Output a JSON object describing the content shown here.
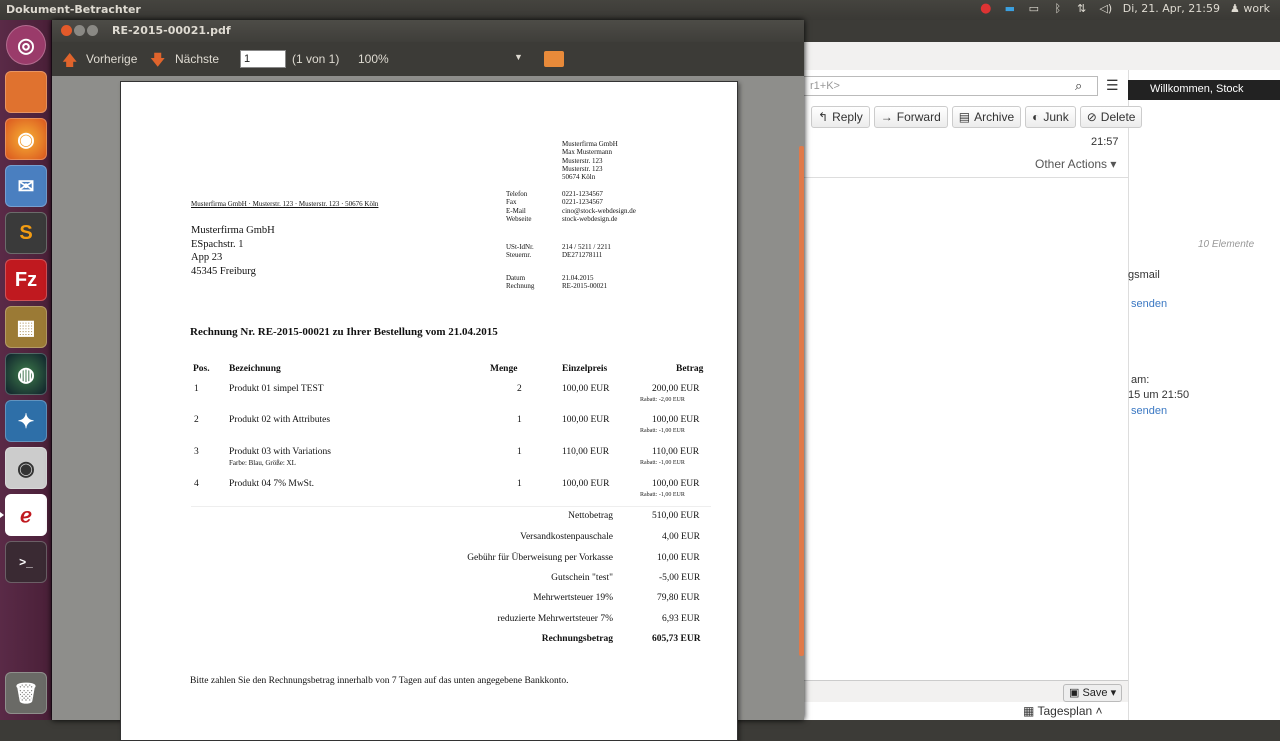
{
  "topbar": {
    "app_title": "Dokument-Betrachter",
    "datetime": "Di, 21. Apr, 21:59",
    "user": "work"
  },
  "launcher": {
    "items": [
      "ubuntu-icon",
      "files-icon",
      "firefox-icon",
      "thunderbird-icon",
      "sublime-icon",
      "filezilla-icon",
      "calc-icon",
      "earth-icon",
      "bird-icon",
      "webcam-icon",
      "evince-icon",
      "terminal-icon",
      "trash-icon"
    ]
  },
  "viewer": {
    "title": "RE-2015-00021.pdf",
    "prev_label": "Vorherige",
    "next_label": "Nächste",
    "page_value": "1",
    "page_count": "(1 von 1)",
    "zoom": "100%"
  },
  "invoice": {
    "sender_line": "Musterfirma GmbH · Musterstr. 123 · Musterstr. 123 · 50676 Köln",
    "company": [
      "Musterfirma GmbH",
      "Max Mustermann",
      "Musterstr. 123",
      "Musterstr. 123",
      "50674 Köln"
    ],
    "contact_labels": [
      "Telefon",
      "Fax",
      "E-Mail",
      "Webseite"
    ],
    "contact_values": [
      "0221-1234567",
      "0221-1234567",
      "cino@stock-webdesign.de",
      "stock-webdesign.de"
    ],
    "tax_labels": [
      "USt-IdNr.",
      "Steuernr."
    ],
    "tax_values": [
      "214 / 5211 / 2211",
      "DE271278111"
    ],
    "date_labels": [
      "Datum",
      "Rechnung"
    ],
    "date_values": [
      "21.04.2015",
      "RE-2015-00021"
    ],
    "recipient": [
      "Musterfirma GmbH",
      "ESpachstr. 1",
      "App 23",
      "45345 Freiburg"
    ],
    "heading": "Rechnung Nr. RE-2015-00021 zu Ihrer Bestellung vom 21.04.2015",
    "columns": [
      "Pos.",
      "Bezeichnung",
      "Menge",
      "Einzelpreis",
      "Betrag"
    ],
    "rows": [
      {
        "pos": "1",
        "name": "Produkt 01 simpel TEST",
        "sub": "",
        "qty": "2",
        "unit": "100,00 EUR",
        "total": "200,00 EUR",
        "rabatt": "Rabatt: -2,00 EUR"
      },
      {
        "pos": "2",
        "name": "Produkt 02 with Attributes",
        "sub": "",
        "qty": "1",
        "unit": "100,00 EUR",
        "total": "100,00 EUR",
        "rabatt": "Rabatt: -1,00 EUR"
      },
      {
        "pos": "3",
        "name": "Produkt 03 with Variations",
        "sub": "Farbe: Blau, Größe: XL",
        "qty": "1",
        "unit": "110,00 EUR",
        "total": "110,00 EUR",
        "rabatt": "Rabatt: -1,00 EUR"
      },
      {
        "pos": "4",
        "name": "Produkt 04 7% MwSt.",
        "sub": "",
        "qty": "1",
        "unit": "100,00 EUR",
        "total": "100,00 EUR",
        "rabatt": "Rabatt: -1,00 EUR"
      }
    ],
    "summary": [
      {
        "label": "Nettobetrag",
        "value": "510,00 EUR"
      },
      {
        "label": "Versandkostenpauschale",
        "value": "4,00 EUR"
      },
      {
        "label": "Gebühr für Überweisung per Vorkasse",
        "value": "10,00 EUR"
      },
      {
        "label": "Gutschein \"test\"",
        "value": "-5,00 EUR"
      },
      {
        "label": "Mehrwertsteuer 19%",
        "value": "79,80 EUR"
      },
      {
        "label": "reduzierte Mehrwertsteuer 7%",
        "value": "6,93 EUR"
      },
      {
        "label": "Rechnungsbetrag",
        "value": "605,73 EUR"
      }
    ],
    "footer": "Bitte zahlen Sie den Rechnungsbetrag innerhalb von 7 Tagen auf das unten angegebene Bankkonto."
  },
  "email": {
    "search_placeholder": "r1+K>",
    "reply": "Reply",
    "forward": "Forward",
    "archive": "Archive",
    "junk": "Junk",
    "delete": "Delete",
    "time": "21:57",
    "other_actions": "Other Actions ▾",
    "welcome": "Willkommen, Stock",
    "count": "10 Elemente",
    "gsmail": "gsmail",
    "senden1": "senden",
    "am": "am:",
    "um": "15 um 21:50",
    "senden2": "senden",
    "save": "Save",
    "tagesplan": "Tagesplan"
  }
}
